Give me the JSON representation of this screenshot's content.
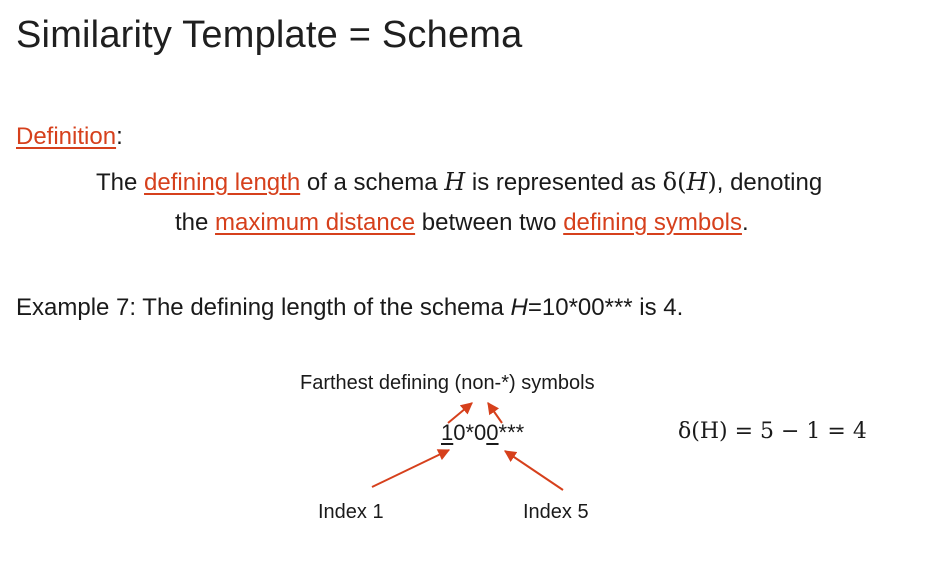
{
  "title": "Similarity Template = Schema",
  "definition": {
    "label": "Definition",
    "colon": ":",
    "line1_a": "The ",
    "line1_term": "defining length",
    "line1_b": " of a schema ",
    "line1_H": "H",
    "line1_c": " is represented as ",
    "line1_delta": "δ(",
    "line1_deltaH": "H",
    "line1_close": ")",
    "line1_d": ", denoting",
    "line2_a": "the ",
    "line2_term1": "maximum distance",
    "line2_b": " between two ",
    "line2_term2": "defining symbols",
    "line2_end": "."
  },
  "example": {
    "prefix": "Example 7: The defining length of the schema ",
    "schema_var": "H",
    "schema_value": "=10*00*** is 4."
  },
  "diagram": {
    "caption": "Farthest defining (non-*) symbols",
    "schema_first": "1",
    "schema_mid": "0*0",
    "schema_last": "0",
    "schema_rest": "***",
    "formula": "δ(H) = 5 − 1 = 4",
    "index1_label": "Index 1",
    "index5_label": "Index 5"
  },
  "colors": {
    "accent": "#d6401c",
    "text": "#1a1a1a"
  }
}
